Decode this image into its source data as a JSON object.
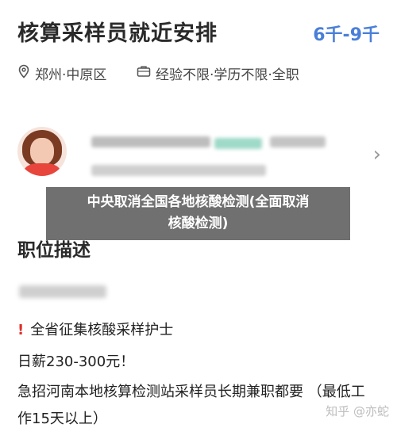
{
  "job": {
    "title": "核算采样员就近安排",
    "salary": "6千-9千",
    "location": "郑州·中原区",
    "requirements": "经验不限·学历不限·全职"
  },
  "icons": {
    "location": "map-pin-icon",
    "requirements": "briefcase-icon",
    "chevron": "chevron-right-icon"
  },
  "overlay": {
    "line1": "中央取消全国各地核酸检测(全面取消",
    "line2": "核酸检测)"
  },
  "description": {
    "title": "职位描述",
    "lines": [
      "全省征集核酸采样护士",
      "日薪230-300元！",
      "急招河南本地核算检测站采样员长期兼职都要 （最低工",
      "作15天以上）"
    ]
  },
  "watermark": "知乎 @亦蛇",
  "colors": {
    "salary": "#4a7fd8",
    "warning": "#e0302a",
    "overlay": "#505050"
  }
}
